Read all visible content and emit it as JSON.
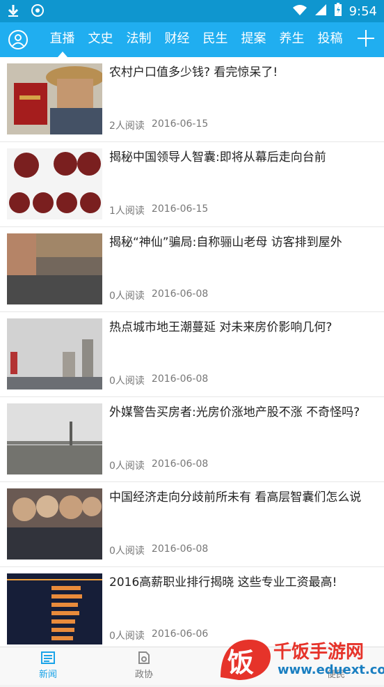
{
  "status_bar": {
    "time": "9:54",
    "icons": [
      "download-icon",
      "app-icon",
      "wifi-icon",
      "battery-icon"
    ]
  },
  "nav": {
    "tabs": [
      "直播",
      "文史",
      "法制",
      "财经",
      "民生",
      "提案",
      "养生",
      "投稿"
    ],
    "active_tab": "直播"
  },
  "articles": [
    {
      "title": "农村户口值多少钱? 看完惊呆了!",
      "reads": "2人阅读",
      "date": "2016-06-15"
    },
    {
      "title": "揭秘中国领导人智囊:即将从幕后走向台前",
      "reads": "1人阅读",
      "date": "2016-06-15"
    },
    {
      "title": "揭秘“神仙”骗局:自称骊山老母 访客排到屋外",
      "reads": "0人阅读",
      "date": "2016-06-08"
    },
    {
      "title": "热点城市地王潮蔓延 对未来房价影响几何?",
      "reads": "0人阅读",
      "date": "2016-06-08"
    },
    {
      "title": "外媒警告买房者:光房价涨地产股不涨 不奇怪吗?",
      "reads": "0人阅读",
      "date": "2016-06-08"
    },
    {
      "title": "中国经济走向分歧前所未有 看高层智囊们怎么说",
      "reads": "0人阅读",
      "date": "2016-06-08"
    },
    {
      "title": "2016高薪职业排行揭晓 这些专业工资最高!",
      "reads": "0人阅读",
      "date": "2016-06-06"
    }
  ],
  "bottom_tabs": [
    {
      "label": "新闻",
      "active": true
    },
    {
      "label": "政协",
      "active": false
    },
    {
      "label": "",
      "active": false
    },
    {
      "label": "便民",
      "active": false
    }
  ],
  "colors": {
    "nav_bg": "#20aef0",
    "status_bg": "#0f96cf",
    "accent": "#1aa3e8"
  },
  "watermark": {
    "brand": "千饭手游网",
    "url": "www.eduext.com"
  }
}
